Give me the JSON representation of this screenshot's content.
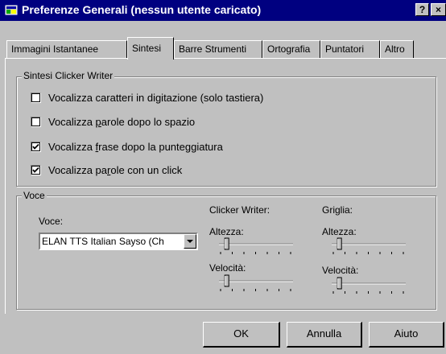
{
  "window": {
    "title": "Preferenze Generali  (nessun utente caricato)",
    "help_label": "?",
    "close_label": "×"
  },
  "tabs": [
    {
      "label": "Immagini Istantanee"
    },
    {
      "label": "Sintesi",
      "active": true
    },
    {
      "label": "Barre Strumenti"
    },
    {
      "label": "Ortografia"
    },
    {
      "label": "Puntatori"
    },
    {
      "label": "Altro"
    }
  ],
  "sintesi_group": {
    "legend": "Sintesi Clicker Writer",
    "options": [
      {
        "before": "Vocalizza caratteri in digitazione (solo tastiera)",
        "mnemonic": "",
        "after": "",
        "checked": false
      },
      {
        "before": "Vocalizza ",
        "mnemonic": "p",
        "after": "arole dopo lo spazio",
        "checked": false
      },
      {
        "before": "Vocalizza ",
        "mnemonic": "f",
        "after": "rase dopo la punteggiatura",
        "checked": true
      },
      {
        "before": "Vocalizza pa",
        "mnemonic": "r",
        "after": "ole con un click",
        "checked": true
      }
    ]
  },
  "voce_group": {
    "legend": "Voce",
    "voice_label": "Voce:",
    "voice_value": "ELAN TTS Italian Sayso (Ch",
    "clicker_label": "Clicker Writer:",
    "griglia_label": "Griglia:",
    "altezza_label": "Altezza:",
    "velocita_label": "Velocità:"
  },
  "sliders": {
    "clicker_altezza": 0.1,
    "clicker_velocita": 0.1,
    "griglia_altezza": 0.1,
    "griglia_velocita": 0.1
  },
  "buttons": {
    "ok": "OK",
    "annulla": "Annulla",
    "aiuto": "Aiuto"
  }
}
